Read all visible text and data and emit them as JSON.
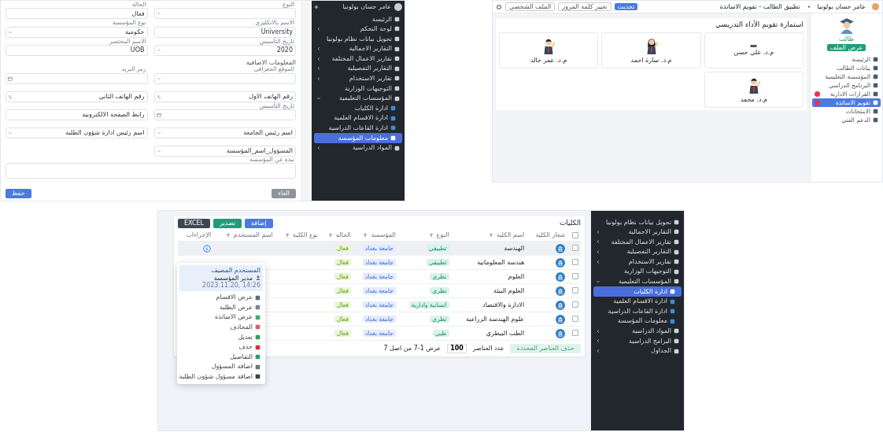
{
  "form_screen": {
    "sidebar": {
      "user": "عامر حسان بولونيا",
      "items": [
        {
          "label": "الرئيسة",
          "selected": false
        },
        {
          "label": "لوحة التحكم",
          "expanded": false,
          "selected": false
        },
        {
          "label": "تحويل بيانات نظام بولونيا",
          "selected": false
        },
        {
          "label": "التقارير الاجمالية",
          "expanded": false,
          "selected": false
        },
        {
          "label": "تقارير الاعمال المختلفة",
          "expanded": false,
          "selected": false
        },
        {
          "label": "التقارير التفصيلية",
          "expanded": false,
          "selected": false
        },
        {
          "label": "تقارير الاستخدام",
          "expanded": false,
          "selected": false
        },
        {
          "label": "التوجيهات الوزارية",
          "selected": false
        },
        {
          "label": "المؤسسات التعليمية",
          "expanded": true,
          "selected": false,
          "children": [
            {
              "label": "ادارة الكليات",
              "selected": false
            },
            {
              "label": "ادارة الاقسام العلمية",
              "selected": false
            },
            {
              "label": "ادارة القاعات الدراسية",
              "selected": false
            },
            {
              "label": "معلومات المؤسسة",
              "selected": true
            }
          ]
        },
        {
          "label": "المواد الدراسية",
          "expanded": false,
          "selected": false
        }
      ]
    },
    "field_rows": [
      [
        {
          "kind": "select",
          "label": "النوع"
        },
        {
          "kind": "text",
          "label": "الحالة",
          "value": "فعال"
        }
      ],
      [
        {
          "kind": "text",
          "label": "الاسم بالانكليزي",
          "value": "University"
        },
        {
          "kind": "select",
          "label": "نوع المؤسسة",
          "value": "حكومية"
        }
      ],
      [
        {
          "kind": "select",
          "label": "تاريخ التأسيس",
          "value": "2020"
        },
        {
          "kind": "text",
          "label": "الاسم المختصر",
          "value": "UOB"
        }
      ]
    ],
    "section_title": "المعلومات الاضافية",
    "extra_rows": [
      [
        {
          "kind": "select",
          "label": "الموقع الجغرافي"
        },
        {
          "kind": "date",
          "label": "رمز البريد"
        }
      ],
      [
        {
          "kind": "phone",
          "value": "رقم الهاتف الاول"
        },
        {
          "kind": "phone",
          "value": "رقم الهاتف الثاني"
        }
      ],
      [
        {
          "kind": "date",
          "label": "تاريخ التأسيس"
        },
        {
          "kind": "text",
          "value": "رابط الصفحة الالكترونية"
        }
      ],
      [
        {
          "kind": "select",
          "value": "اسم رئيس الجامعة"
        },
        {
          "kind": "select",
          "value": "اسم رئيس ادارة شؤون الطلبة"
        }
      ],
      [
        {
          "kind": "select",
          "value": "المسؤول_اسم_المؤسسة"
        }
      ]
    ],
    "textarea_label": "نبذة عن المؤسسة",
    "cancel_button": "الغاء",
    "save_button": "حفظ"
  },
  "student_screen": {
    "user": "عامر حسان بولونيا",
    "breadcrumb": "تطبيق الطالب - تقويم الاساتذة",
    "header_buttons": [
      {
        "label": "تحديث",
        "primary": true
      },
      {
        "label": "تغيير كلمة المرور",
        "primary": false
      },
      {
        "label": "الملف الشخصي",
        "primary": false
      }
    ],
    "role": "طالب",
    "profile_button": "عرض الملف",
    "menu": [
      {
        "label": "الرئيسة",
        "selected": false,
        "alert": false
      },
      {
        "label": "بيانات الطالب",
        "selected": false,
        "alert": false
      },
      {
        "label": "المؤسسة التعليمية",
        "selected": false,
        "alert": false
      },
      {
        "label": "البرنامج الدراسي",
        "selected": false,
        "alert": false
      },
      {
        "label": "القرارات الادارية",
        "selected": false,
        "alert": true
      },
      {
        "label": "تقويم الاساتذة",
        "selected": true,
        "alert": true
      },
      {
        "label": "الامتحانات",
        "selected": false,
        "alert": false
      },
      {
        "label": "الدعم الفني",
        "selected": false,
        "alert": false
      }
    ],
    "form_title": "استمارة تقويم الأداء التدريسي",
    "teachers": [
      {
        "name": "م.د. علي حسن",
        "kind": "blank"
      },
      {
        "name": "م.د. سارة احمد",
        "kind": "female"
      },
      {
        "name": "م.د. عمر خالد",
        "kind": "male"
      },
      {
        "name": "م.د. محمد",
        "kind": "male"
      }
    ]
  },
  "colleges_screen": {
    "title": "الكليات",
    "toolbar": [
      {
        "label": "إضافة",
        "kind": "primary"
      },
      {
        "label": "تصدير",
        "kind": "success"
      },
      {
        "label": "EXCEL",
        "kind": "dark"
      }
    ],
    "select_all": false,
    "columns": [
      {
        "label": "شعار الكلية",
        "filter": false
      },
      {
        "label": "اسم الكلية",
        "filter": true
      },
      {
        "label": "النوع",
        "filter": true
      },
      {
        "label": "المؤسسة",
        "filter": true
      },
      {
        "label": "الحالة",
        "filter": true
      },
      {
        "label": "نوع الكلية",
        "filter": true
      },
      {
        "label": "اسم المستخدم",
        "filter": true
      },
      {
        "label": "الإجراءات",
        "filter": false
      }
    ],
    "rows": [
      {
        "checked": false,
        "selected": true,
        "name": "الهندسة",
        "type": "تطبيقي",
        "institution": "جامعة بغداد",
        "status": "فعال"
      },
      {
        "checked": false,
        "selected": false,
        "name": "هندسة المعلوماتية",
        "type": "تطبيقي",
        "institution": "جامعة بغداد",
        "status": "فعال"
      },
      {
        "checked": false,
        "selected": false,
        "name": "العلوم",
        "type": "نظري",
        "institution": "جامعة بغداد",
        "status": "فعال"
      },
      {
        "checked": false,
        "selected": false,
        "name": "العلوم البيئة",
        "type": "نظري",
        "institution": "جامعة بغداد",
        "status": "فعال"
      },
      {
        "checked": false,
        "selected": false,
        "name": "الادارة والاقتصاد",
        "type": "انسانية وادارية",
        "institution": "جامعة بغداد",
        "status": "فعال"
      },
      {
        "checked": false,
        "selected": false,
        "name": "علوم الهندسة الزراعية",
        "type": "نظري",
        "institution": "جامعة بغداد",
        "status": "فعال"
      },
      {
        "checked": false,
        "selected": false,
        "name": "الطب البيطري",
        "type": "طبي",
        "institution": "جامعة بغداد",
        "status": "فعال"
      }
    ],
    "delete_selected": "حذف العناصر المحددة",
    "page_size_label": "عدد العناصر",
    "page_size": "100",
    "range_text": "عرض 1-7 من اصل 7",
    "menu": {
      "title": "المستخدم المضيف",
      "role": "مدير المؤسسة",
      "time": "2023.11.20, 14:26",
      "items": [
        {
          "label": "عرض الاقسام",
          "color": "#5b6b7f"
        },
        {
          "label": "عرض الطلبة",
          "color": "#7a8796"
        },
        {
          "label": "عرض الاساتذة",
          "color": "#2fb36d"
        },
        {
          "label": "المحاذف",
          "color": "#e25a6a"
        },
        {
          "label": "تعديل",
          "color": "#2f9e57"
        },
        {
          "label": "حذف",
          "color": "#e02d3c"
        },
        {
          "label": "التفاصيل",
          "color": "#25a06a"
        },
        {
          "label": "اضافة المسؤول",
          "color": "#6c757d"
        },
        {
          "label": "اضافة مسؤول شؤون الطلبة",
          "color": "#3a3f47"
        }
      ]
    },
    "sidebar": [
      {
        "label": "تحويل بيانات نظام بولونيا",
        "selected": false
      },
      {
        "label": "التقارير الاجمالية",
        "expanded": false,
        "selected": false
      },
      {
        "label": "تقارير الاعمال المختلفة",
        "expanded": false,
        "selected": false
      },
      {
        "label": "التقارير التفصيلية",
        "expanded": false,
        "selected": false
      },
      {
        "label": "تقارير الاستخدام",
        "expanded": false,
        "selected": false
      },
      {
        "label": "التوجيهات الوزارية",
        "selected": false
      },
      {
        "label": "المؤسسات التعليمية",
        "expanded": true,
        "selected": false,
        "children": [
          {
            "label": "ادارة الكليات",
            "selected": true
          },
          {
            "label": "ادارة الاقسام العلمية",
            "selected": false
          },
          {
            "label": "ادارة القاعات الدراسية",
            "selected": false
          },
          {
            "label": "معلومات المؤسسة",
            "selected": false
          }
        ]
      },
      {
        "label": "المواد الدراسية",
        "expanded": false,
        "selected": false
      },
      {
        "label": "البرامج الدراسية",
        "expanded": false,
        "selected": false
      },
      {
        "label": "الجداول",
        "expanded": false,
        "selected": false
      }
    ]
  }
}
